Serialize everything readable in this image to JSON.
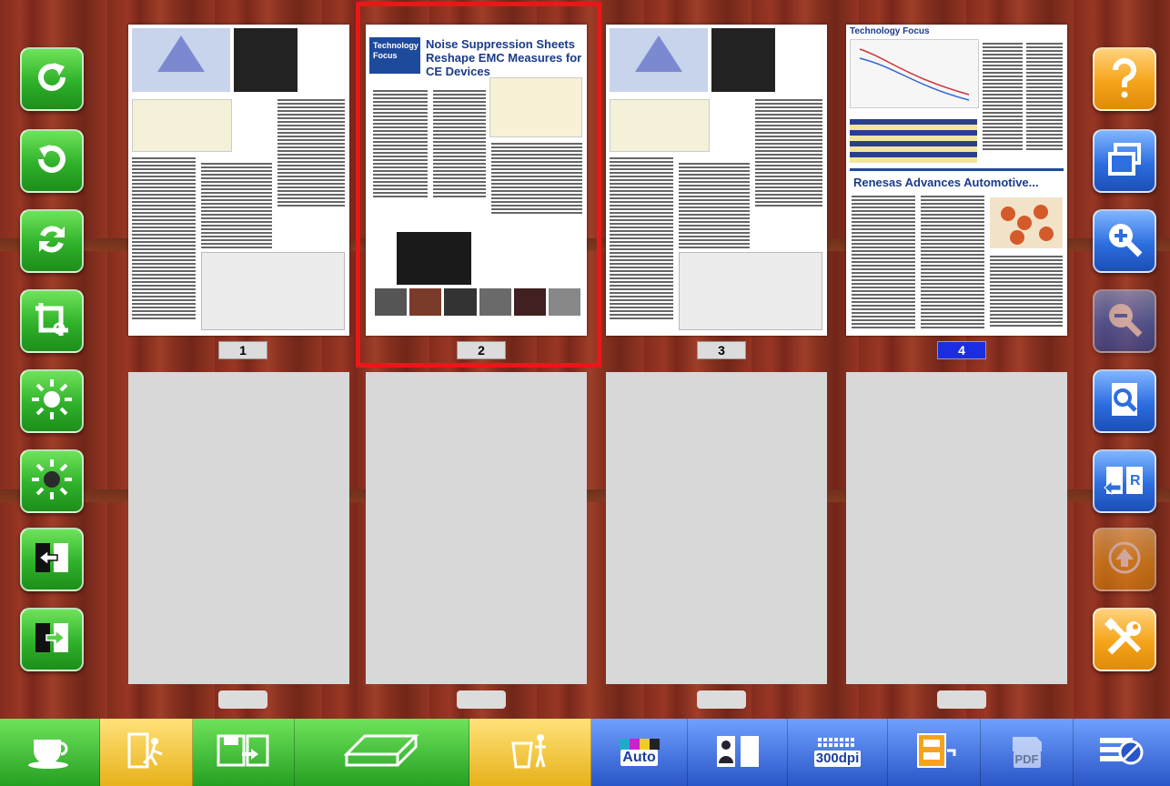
{
  "left_toolbar": [
    {
      "name": "rotate-right",
      "icon": "rotate-clockwise-icon"
    },
    {
      "name": "rotate-left",
      "icon": "rotate-counterclockwise-icon"
    },
    {
      "name": "rotate-180",
      "icon": "rotate-both-icon"
    },
    {
      "name": "crop",
      "icon": "crop-icon"
    },
    {
      "name": "brightness-up",
      "icon": "sun-bright-icon"
    },
    {
      "name": "brightness-down",
      "icon": "sun-dim-icon"
    },
    {
      "name": "move-page-left",
      "icon": "swap-arrows-icon"
    },
    {
      "name": "insert-page",
      "icon": "insert-page-icon"
    }
  ],
  "right_toolbar": [
    {
      "name": "help",
      "icon": "question-icon"
    },
    {
      "name": "duplicate",
      "icon": "windows-icon"
    },
    {
      "name": "zoom-in",
      "icon": "zoom-in-icon"
    },
    {
      "name": "zoom-out",
      "icon": "zoom-out-icon"
    },
    {
      "name": "preview",
      "icon": "document-search-icon"
    },
    {
      "name": "replace",
      "icon": "book-replace-icon"
    },
    {
      "name": "upload",
      "icon": "up-arrow-icon"
    },
    {
      "name": "settings",
      "icon": "tools-icon"
    }
  ],
  "pages": [
    {
      "number": "1",
      "selected": false
    },
    {
      "number": "2",
      "selected": false,
      "highlighted": true,
      "headline": "Noise Suppression Sheets Reshape EMC Measures for CE Devices",
      "section": "Technology Focus"
    },
    {
      "number": "3",
      "selected": false
    },
    {
      "number": "4",
      "selected": true,
      "section": "Technology Focus",
      "headline": "Renesas Advances Automotive..."
    }
  ],
  "bottom_bar": [
    {
      "name": "break",
      "icon": "coffee-cup-icon"
    },
    {
      "name": "exit",
      "icon": "exit-door-icon"
    },
    {
      "name": "save",
      "icon": "save-disk-icon"
    },
    {
      "name": "scan",
      "icon": "scanner-icon"
    },
    {
      "name": "delete",
      "icon": "trash-icon"
    },
    {
      "name": "auto-color",
      "icon": "auto-icon",
      "label": "Auto"
    },
    {
      "name": "book-mode",
      "icon": "book-person-icon"
    },
    {
      "name": "resolution",
      "icon": "dpi-icon",
      "label": "300dpi"
    },
    {
      "name": "file-output",
      "icon": "cabinet-icon"
    },
    {
      "name": "pdf",
      "icon": "pdf-icon",
      "label": "PDF"
    },
    {
      "name": "settings-tools",
      "icon": "settings-icon"
    }
  ],
  "colors": {
    "selection": "#e81818",
    "green": "#2fb12a",
    "orange": "#f5a419",
    "blue": "#2d6ee0",
    "selected_tab": "#1b2de0"
  }
}
